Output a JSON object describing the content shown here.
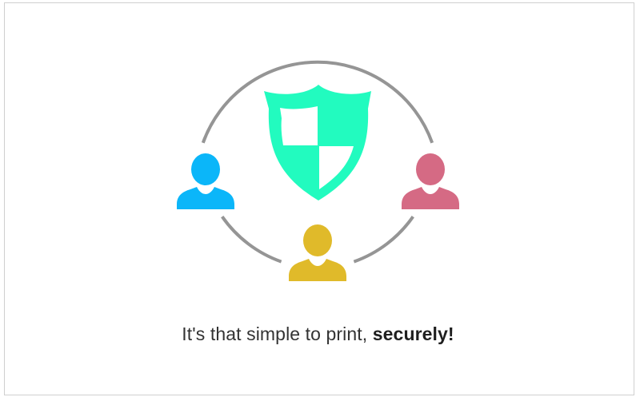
{
  "caption": {
    "text_regular": "It's that simple to print, ",
    "text_bold": "securely!"
  },
  "colors": {
    "ring": "#959595",
    "shield": "#22fbbf",
    "user_left": "#0bb6f9",
    "user_right": "#d56a84",
    "user_bottom": "#e0ba2a",
    "text": "#333333"
  },
  "icons": {
    "shield": "shield-icon",
    "user_left": "user-icon",
    "user_right": "user-icon",
    "user_bottom": "user-icon"
  }
}
